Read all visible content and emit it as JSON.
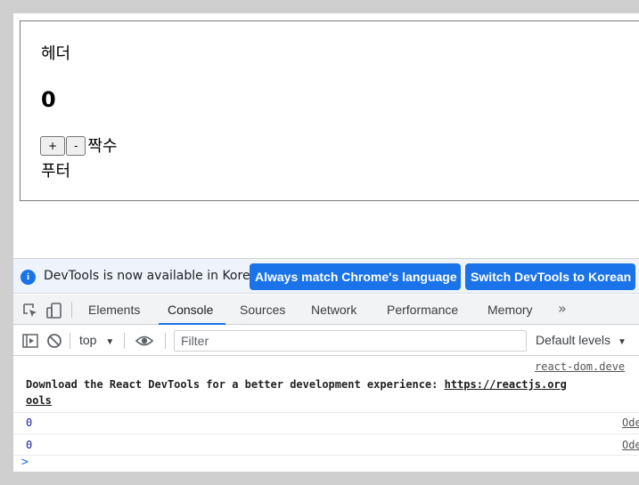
{
  "page": {
    "header": "헤더",
    "count": "0",
    "plus_label": "+",
    "minus_label": "-",
    "parity": "짝수",
    "footer": "푸터"
  },
  "devtools": {
    "infobar": {
      "text": "DevTools is now available in Korean!",
      "match_button": "Always match Chrome's language",
      "switch_button": "Switch DevTools to Korean"
    },
    "tabs": [
      "Elements",
      "Console",
      "Sources",
      "Network",
      "Performance",
      "Memory"
    ],
    "active_tab": "Console",
    "more_tabs": "»",
    "toolbar": {
      "context": "top",
      "filter_placeholder": "Filter",
      "levels": "Default levels"
    },
    "console": {
      "source_1": "react-dom.deve",
      "react_message": "Download the React DevTools for a better development experience: ",
      "react_link": "https://reactjs.org",
      "react_link_cont": "ools",
      "log_1": "0",
      "source_2": "Ode",
      "log_2": "0",
      "source_3": "Ode",
      "prompt": ">"
    }
  }
}
